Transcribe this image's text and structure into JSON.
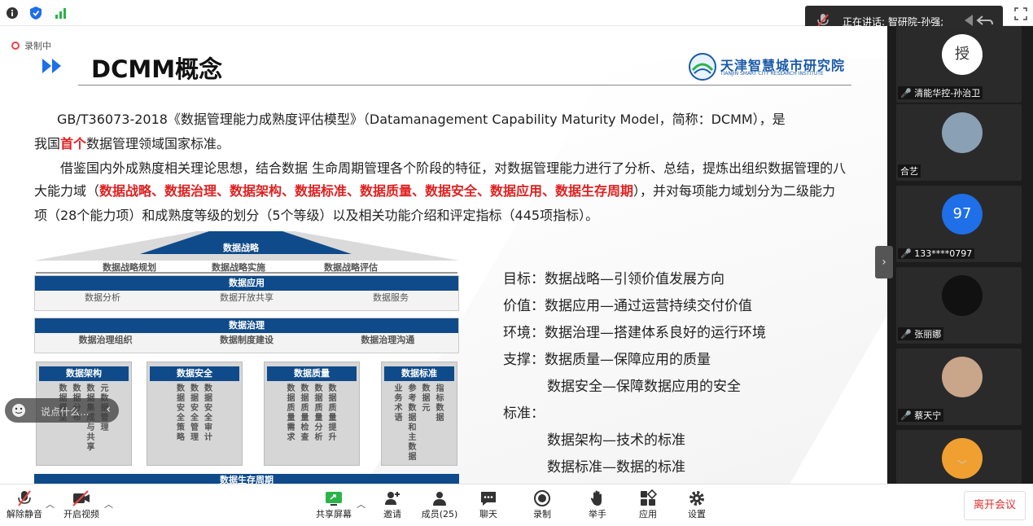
{
  "topbar": {
    "icons": [
      "info-icon",
      "shield-icon",
      "signal-icon"
    ],
    "speaking_label": "正在讲话: 智研院-孙强;",
    "fullscreen_icon": "fullscreen-icon"
  },
  "slide": {
    "recording_label": "录制中",
    "title": "DCMM概念",
    "logo_cn": "天津智慧城市研究院",
    "logo_en": "TIANJIN SMART CITY RESEARCH INSTITUTE",
    "para1_a": "GB/T36073-2018《数据管理能力成熟度评估模型》（Datamanagement Capability Maturity Model，简称：DCMM），是",
    "para1_b_pre": "我国",
    "para1_b_red": "首个",
    "para1_b_post": "数据管理领域国家标准。",
    "para2_a": "借鉴国内外成熟度相关理论思想，结合数据 生命周期管理各个阶段的特征，对数据管理能力进行了分析、总结，提炼出组织数据管理的八",
    "para2_b_pre": "大能力域（",
    "para2_b_red": "数据战略、数据治理、数据架构、数据标准、数据质量、数据安全、数据应用、数据生存周期",
    "para2_b_post": "），并对每项能力域划分为二级能力",
    "para2_c": "项（28个能力项）和成熟度等级的划分（5个等级）以及相关功能介绍和评定指标（445项指标）。",
    "house": {
      "roof_title": "数据战略",
      "roof_items": [
        "数据战略规划",
        "数据战略实施",
        "数据战略评估"
      ],
      "app_title": "数据应用",
      "app_items": [
        "数据分析",
        "数据开放共享",
        "数据服务"
      ],
      "gov_title": "数据治理",
      "gov_items": [
        "数据治理组织",
        "数据制度建设",
        "数据治理沟通"
      ],
      "columns": [
        {
          "title": "数据架构",
          "items": [
            "数据模型",
            "数据分布",
            "数据集成与共享",
            "元数据管理"
          ]
        },
        {
          "title": "数据安全",
          "items": [
            "数据安全策略",
            "数据安全管理",
            "数据安全审计"
          ]
        },
        {
          "title": "数据质量",
          "items": [
            "数据质量需求",
            "数据质量检查",
            "数据质量分析",
            "数据质量提升"
          ]
        },
        {
          "title": "数据标准",
          "items": [
            "业务术语",
            "参考数据和主数据",
            "数据元",
            "指标数据"
          ]
        }
      ],
      "lifecycle": "数据生存周期"
    },
    "right_list": [
      "目标：数据战略—引领价值发展方向",
      "价值：数据应用—通过运营持续交付价值",
      "环境：数据治理—搭建体系良好的运行环境",
      "支撑：数据质量—保障应用的质量",
      "数据安全—保障数据应用的安全",
      "标准：",
      "数据架构—技术的标准",
      "数据标准—数据的标准"
    ],
    "comment_placeholder": "说点什么..."
  },
  "participants": [
    {
      "name": "清能华控-孙治卫",
      "avatar_text": "授",
      "muted": true
    },
    {
      "name": "合艺",
      "avatar_text": "",
      "muted": false
    },
    {
      "name": "133****0797",
      "avatar_text": "97",
      "muted": true
    },
    {
      "name": "张丽娜",
      "avatar_text": "",
      "muted": true
    },
    {
      "name": "蔡天宁",
      "avatar_text": "",
      "muted": true
    },
    {
      "name": "",
      "avatar_text": "",
      "muted": false
    }
  ],
  "toolbar": {
    "unmute": "解除静音",
    "start_video": "开启视频",
    "share_screen": "共享屏幕",
    "invite": "邀请",
    "members": "成员(25)",
    "chat": "聊天",
    "record": "录制",
    "raise_hand": "举手",
    "apps": "应用",
    "settings": "设置",
    "leave": "离开会议"
  },
  "colors": {
    "accent_blue": "#0f4b8a",
    "highlight_red": "#e02020",
    "leave_red": "#e0302e",
    "avatar_blue": "#1e6fe8"
  }
}
